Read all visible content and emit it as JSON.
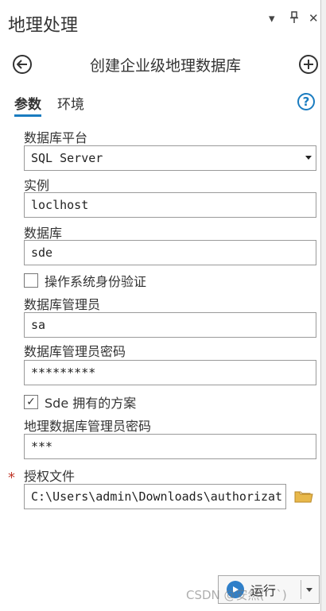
{
  "panel": {
    "title": "地理处理",
    "controls": {
      "menu": "▾",
      "pin": "⊤",
      "close": "✕"
    }
  },
  "tool": {
    "title": "创建企业级地理数据库",
    "back_icon": "arrow-left-icon",
    "add_icon": "plus-icon"
  },
  "tabs": {
    "parameters": "参数",
    "environments": "环境",
    "help_label": "?"
  },
  "fields": {
    "platform": {
      "label": "数据库平台",
      "value": "SQL Server"
    },
    "instance": {
      "label": "实例",
      "value": "loclhost"
    },
    "database": {
      "label": "数据库",
      "value": "sde"
    },
    "os_auth": {
      "label": "操作系统身份验证",
      "checked": false
    },
    "db_admin": {
      "label": "数据库管理员",
      "value": "sa"
    },
    "db_admin_password": {
      "label": "数据库管理员密码",
      "value": "*********"
    },
    "sde_schema": {
      "label": "Sde 拥有的方案",
      "checked": true,
      "mark": "✓"
    },
    "gdb_admin_password": {
      "label": "地理数据库管理员密码",
      "value": "***"
    },
    "authorization_file": {
      "label": "授权文件",
      "required_mark": "*",
      "value": "C:\\Users\\admin\\Downloads\\authorizat"
    }
  },
  "run": {
    "label": "运行"
  },
  "watermark": "CSDN @安然(´˘`)",
  "colors": {
    "accent": "#1a7cc0",
    "required": "#c0392b",
    "run_icon": "#2f7fc9",
    "folder": "#e8b84a"
  }
}
